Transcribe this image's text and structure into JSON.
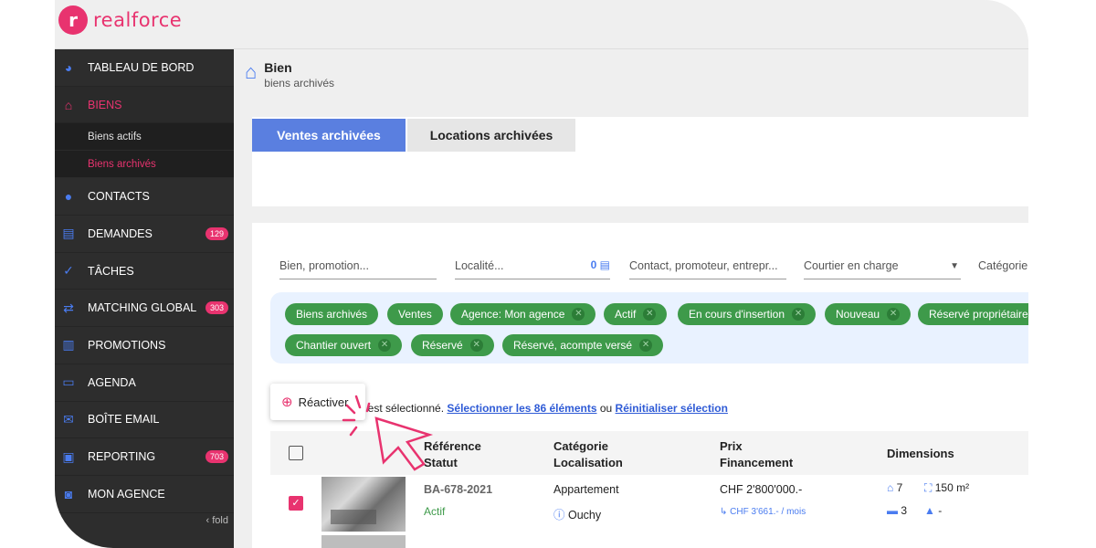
{
  "brand": {
    "logo_letter": "r",
    "name": "realforce"
  },
  "sidebar": {
    "items": [
      {
        "label": "TABLEAU DE BORD",
        "icon": "pie-chart-icon"
      },
      {
        "label": "BIENS",
        "icon": "house-icon",
        "active": true
      },
      {
        "label": "CONTACTS",
        "icon": "user-icon"
      },
      {
        "label": "DEMANDES",
        "icon": "message-icon",
        "badge": "129"
      },
      {
        "label": "TÂCHES",
        "icon": "check-circle-icon"
      },
      {
        "label": "MATCHING GLOBAL",
        "icon": "arrows-icon",
        "badge": "303"
      },
      {
        "label": "PROMOTIONS",
        "icon": "building-icon"
      },
      {
        "label": "AGENDA",
        "icon": "calendar-icon"
      },
      {
        "label": "BOÎTE EMAIL",
        "icon": "mail-icon"
      },
      {
        "label": "REPORTING",
        "icon": "clipboard-icon",
        "badge": "703"
      },
      {
        "label": "MON AGENCE",
        "icon": "agency-icon"
      }
    ],
    "sub_items": [
      {
        "label": "Biens actifs"
      },
      {
        "label": "Biens archivés",
        "active": true
      }
    ],
    "fold_label": "fold"
  },
  "header": {
    "title": "Bien",
    "subtitle": "biens archivés"
  },
  "tabs": [
    {
      "label": "Ventes archivées",
      "active": true
    },
    {
      "label": "Locations archivées"
    }
  ],
  "filters": {
    "property": "Bien, promotion...",
    "locality": "Localité...",
    "locality_count": "0",
    "contact": "Contact, promoteur, entrepr...",
    "broker": "Courtier en charge",
    "category": "Catégorie"
  },
  "chips_row1": [
    "Biens archivés",
    "Ventes",
    "Agence: Mon agence",
    "Actif",
    "En cours d'insertion",
    "Nouveau",
    "Réservé propriétaire"
  ],
  "chips_row2": [
    "Chantier ouvert",
    "Réservé",
    "Réservé, acompte versé"
  ],
  "selection": {
    "text": "t est sélectionné.",
    "select_all": "Sélectionner les 86 éléments",
    "or": "ou",
    "reset": "Réinitialiser sélection"
  },
  "reactivate_label": "Réactiver",
  "table": {
    "headers": [
      {
        "line1": "Référence",
        "line2": "Statut"
      },
      {
        "line1": "Catégorie",
        "line2": "Localisation"
      },
      {
        "line1": "Prix",
        "line2": "Financement"
      },
      {
        "line1": "Dimensions",
        "line2": ""
      }
    ],
    "rows": [
      {
        "reference": "BA-678-2021",
        "status": "Actif",
        "category": "Appartement",
        "location": "Ouchy",
        "price": "CHF 2'800'000.-",
        "financing": "CHF 3'661.- / mois",
        "rooms": "7",
        "surface": "150 m²",
        "bedrooms": "3",
        "floors": "-"
      }
    ]
  },
  "colors": {
    "accent": "#e8336f",
    "primary": "#5a7fe0",
    "chip": "#3e9a4a",
    "sidebar": "#2d2d2d"
  }
}
